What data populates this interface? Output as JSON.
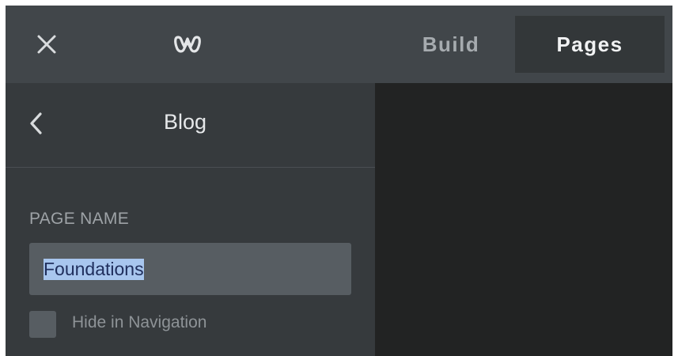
{
  "topbar": {
    "close_icon": "close-icon",
    "logo_icon": "weebly-logo",
    "tabs": [
      {
        "label": "Build",
        "active": false
      },
      {
        "label": "Pages",
        "active": true
      }
    ]
  },
  "sidebar": {
    "back_icon": "chevron-left-icon",
    "title": "Blog",
    "page_name": {
      "label": "PAGE NAME",
      "value": "Foundations"
    },
    "hide_in_navigation": {
      "label": "Hide in Navigation",
      "checked": false
    }
  },
  "colors": {
    "topbar_bg": "#41464a",
    "active_tab_bg": "#333739",
    "sidebar_bg": "#363a3d",
    "input_bg": "#575d62",
    "preview_bg": "#222323",
    "selection": "#a8c6ee"
  }
}
